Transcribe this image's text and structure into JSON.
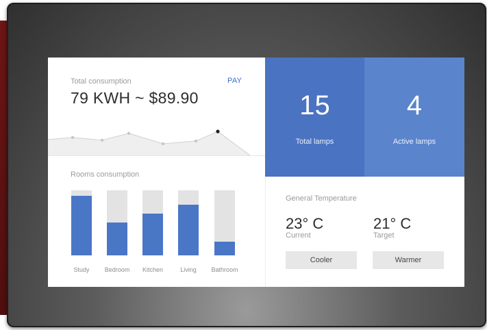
{
  "consumption": {
    "label": "Total consumption",
    "value": "79 KWH ~ $89.90",
    "pay_label": "PAY",
    "trend_points": [
      0.38,
      0.28,
      0.53,
      0.15,
      0.25,
      0.6
    ]
  },
  "rooms": {
    "title": "Rooms consumption",
    "items": [
      {
        "label": "Study",
        "fill": 0.92
      },
      {
        "label": "Bedroom",
        "fill": 0.5
      },
      {
        "label": "Kitchen",
        "fill": 0.64
      },
      {
        "label": "Living",
        "fill": 0.78
      },
      {
        "label": "Bathroom",
        "fill": 0.21
      }
    ]
  },
  "lamps": {
    "total": {
      "value": "15",
      "label": "Total lamps"
    },
    "active": {
      "value": "4",
      "label": "Active lamps"
    }
  },
  "temperature": {
    "title": "General Temperature",
    "current": {
      "value": "23° C",
      "label": "Current"
    },
    "target": {
      "value": "21° C",
      "label": "Target"
    },
    "cooler_label": "Cooler",
    "warmer_label": "Warmer"
  },
  "colors": {
    "accent_blue": "#4a73c2",
    "accent_blue_light": "#5a84cc",
    "bar_fill": "#4a76c6",
    "bar_track": "#e3e3e3"
  }
}
